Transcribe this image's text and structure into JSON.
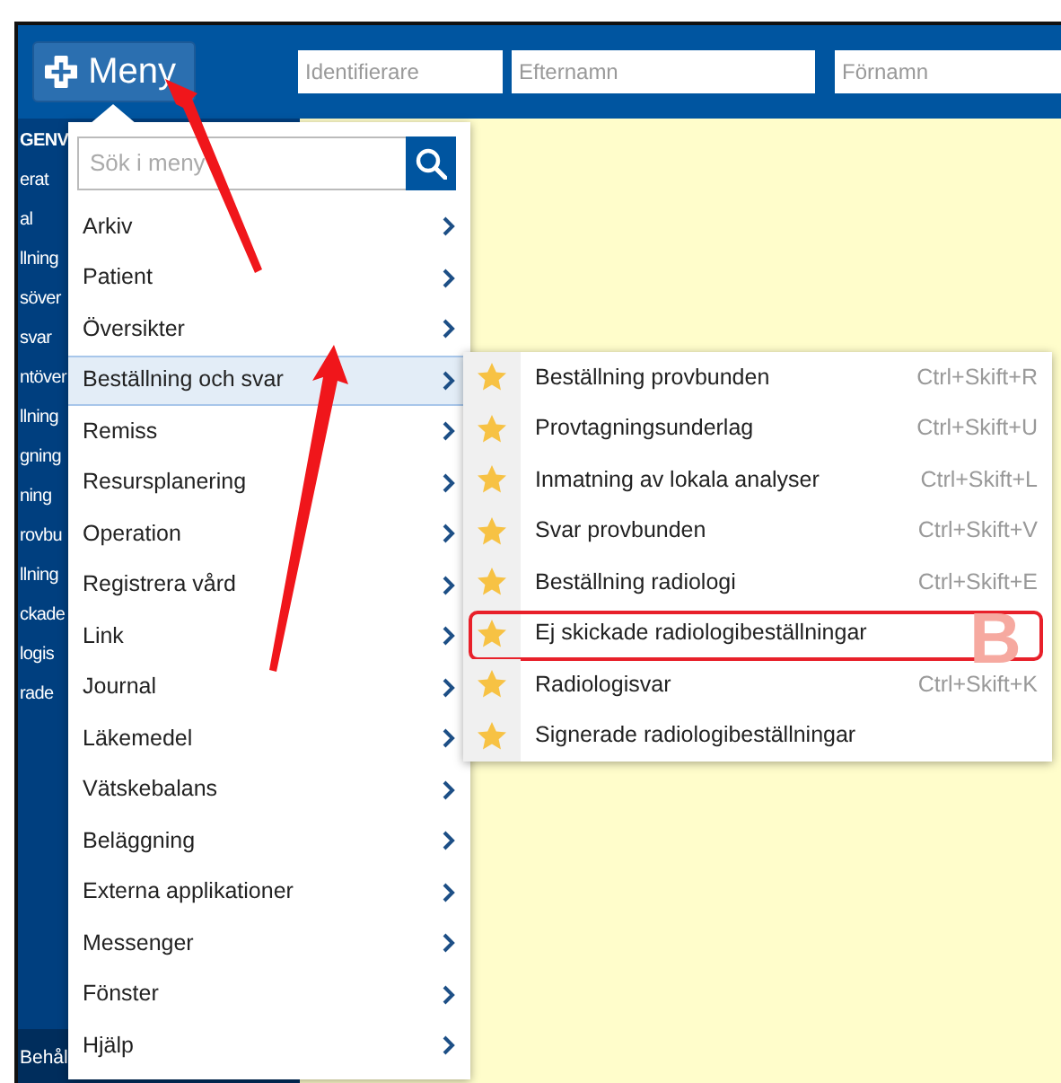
{
  "menu_button": {
    "label": "Meny"
  },
  "fields": [
    {
      "placeholder": "Identifierare"
    },
    {
      "placeholder": "Efternamn"
    },
    {
      "placeholder": "Förnamn"
    }
  ],
  "sidebar": {
    "items": [
      "GENV",
      "erat",
      "al",
      "llning",
      "söver",
      "svar",
      "ntöver",
      "llning",
      "gning",
      "ning",
      "rovbu",
      "llning",
      "ckade",
      "logis",
      "rade"
    ],
    "footer": "Behål"
  },
  "background_text": "B",
  "menu": {
    "search": {
      "placeholder": "Sök i meny"
    },
    "items": [
      {
        "label": "Arkiv",
        "selected": false
      },
      {
        "label": "Patient",
        "selected": false
      },
      {
        "label": "Översikter",
        "selected": false
      },
      {
        "label": "Beställning och svar",
        "selected": true
      },
      {
        "label": "Remiss",
        "selected": false
      },
      {
        "label": "Resursplanering",
        "selected": false
      },
      {
        "label": "Operation",
        "selected": false
      },
      {
        "label": "Registrera vård",
        "selected": false
      },
      {
        "label": "Link",
        "selected": false
      },
      {
        "label": "Journal",
        "selected": false
      },
      {
        "label": "Läkemedel",
        "selected": false
      },
      {
        "label": "Vätskebalans",
        "selected": false
      },
      {
        "label": "Beläggning",
        "selected": false
      },
      {
        "label": "Externa applikationer",
        "selected": false
      },
      {
        "label": "Messenger",
        "selected": false
      },
      {
        "label": "Fönster",
        "selected": false
      },
      {
        "label": "Hjälp",
        "selected": false
      }
    ]
  },
  "submenu": {
    "items": [
      {
        "label": "Beställning provbunden",
        "shortcut": "Ctrl+Skift+R",
        "highlighted": false
      },
      {
        "label": "Provtagningsunderlag",
        "shortcut": "Ctrl+Skift+U",
        "highlighted": false
      },
      {
        "label": "Inmatning av lokala analyser",
        "shortcut": "Ctrl+Skift+L",
        "highlighted": false
      },
      {
        "label": "Svar provbunden",
        "shortcut": "Ctrl+Skift+V",
        "highlighted": false
      },
      {
        "label": "Beställning radiologi",
        "shortcut": "Ctrl+Skift+E",
        "highlighted": false
      },
      {
        "label": "Ej skickade radiologibeställningar",
        "highlighted": true
      },
      {
        "label": "Radiologisvar",
        "shortcut": "Ctrl+Skift+K",
        "highlighted": false
      },
      {
        "label": "Signerade radiologibeställningar",
        "highlighted": false
      }
    ]
  }
}
